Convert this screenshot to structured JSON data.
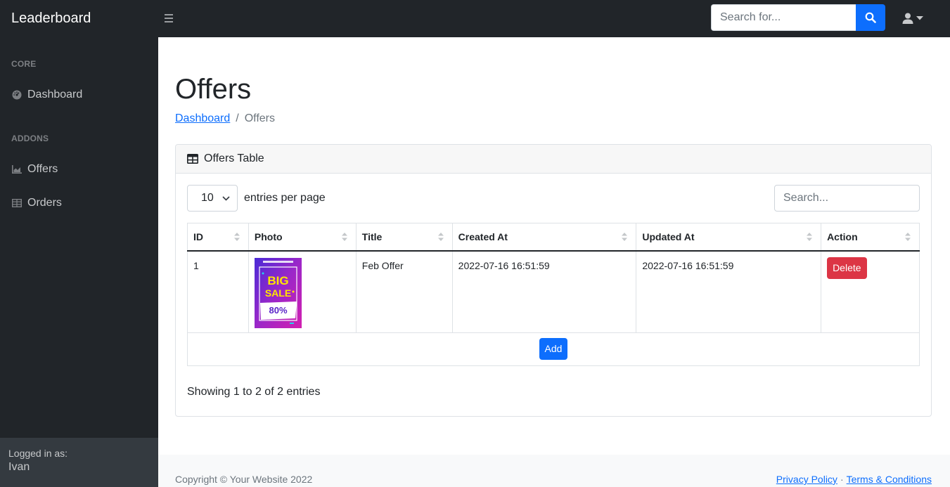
{
  "app": {
    "brand": "Leaderboard"
  },
  "topbar": {
    "search_placeholder": "Search for...",
    "toggle_icon": "hamburger-icon",
    "search_icon": "search-icon",
    "user_icon": "user-icon"
  },
  "sidebar": {
    "sections": [
      {
        "heading": "Core",
        "items": [
          {
            "label": "Dashboard",
            "icon": "tachometer-icon"
          }
        ]
      },
      {
        "heading": "Addons",
        "items": [
          {
            "label": "Offers",
            "icon": "area-chart-icon"
          },
          {
            "label": "Orders",
            "icon": "table-icon"
          }
        ]
      }
    ],
    "footer": {
      "logged_in_label": "Logged in as:",
      "username": "Ivan"
    }
  },
  "page": {
    "title": "Offers",
    "breadcrumb": [
      {
        "label": "Dashboard"
      },
      {
        "separator": "/"
      },
      {
        "label": "Offers"
      }
    ]
  },
  "card": {
    "header": "Offers Table",
    "per_page_value": "10",
    "per_page_label": "entries per page",
    "search_placeholder": "Search...",
    "columns": [
      "ID",
      "Photo",
      "Title",
      "Created At",
      "Updated At",
      "Action"
    ],
    "rows": [
      {
        "id": "1",
        "photo": {
          "top_text": "BIG",
          "mid_text": "SALE",
          "discount": "80%"
        },
        "title": "Feb Offer",
        "created_at": "2022-07-16 16:51:59",
        "updated_at": "2022-07-16 16:51:59",
        "action_label": "Delete"
      }
    ],
    "add_label": "Add",
    "showing": "Showing 1 to 2 of 2 entries"
  },
  "footer": {
    "copyright": "Copyright © Your Website 2022",
    "links": [
      "Privacy Policy",
      "Terms & Conditions"
    ],
    "link_separator": "·"
  },
  "colors": {
    "primary": "#0d6efd",
    "danger": "#dc3545",
    "dark": "#212529"
  }
}
